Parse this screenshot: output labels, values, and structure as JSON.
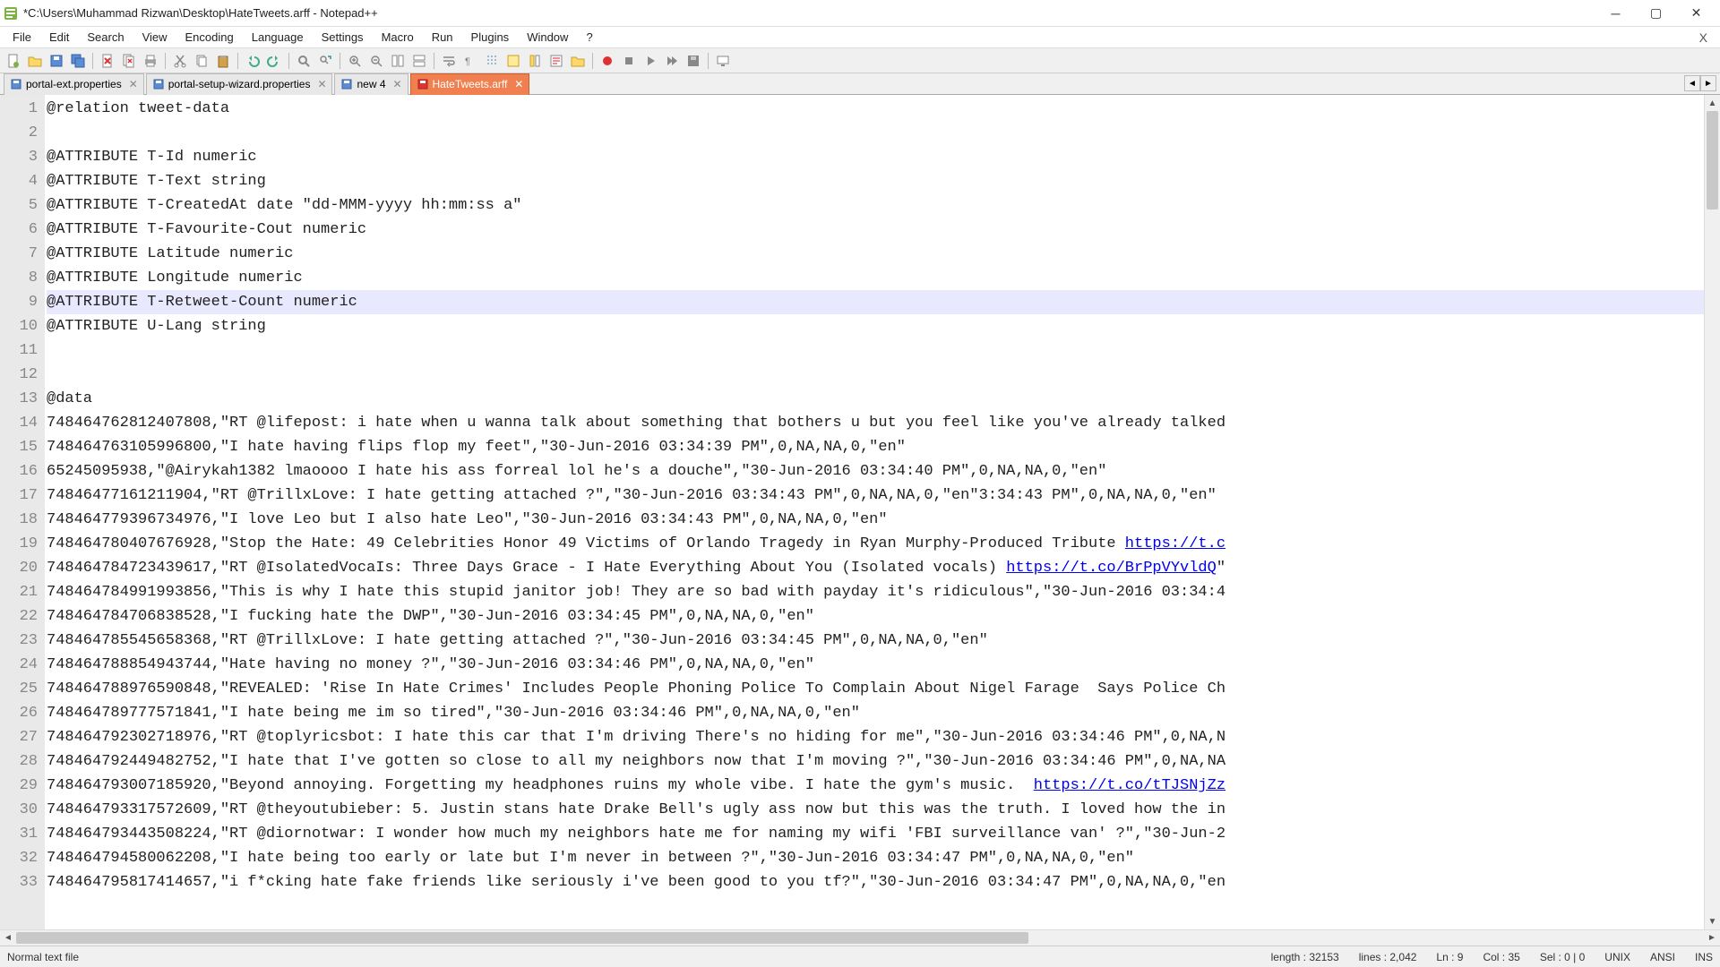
{
  "window": {
    "title": "*C:\\Users\\Muhammad Rizwan\\Desktop\\HateTweets.arff - Notepad++"
  },
  "menu": {
    "items": [
      "File",
      "Edit",
      "Search",
      "View",
      "Encoding",
      "Language",
      "Settings",
      "Macro",
      "Run",
      "Plugins",
      "Window",
      "?"
    ],
    "close_x": "X"
  },
  "tabs": [
    {
      "label": "portal-ext.properties",
      "active": false,
      "dirty": false
    },
    {
      "label": "portal-setup-wizard.properties",
      "active": false,
      "dirty": false
    },
    {
      "label": "new 4",
      "active": false,
      "dirty": false
    },
    {
      "label": "HateTweets.arff",
      "active": true,
      "dirty": true
    }
  ],
  "editor": {
    "current_line_index": 8,
    "lines": [
      "@relation tweet-data",
      "",
      "@ATTRIBUTE T-Id numeric",
      "@ATTRIBUTE T-Text string",
      "@ATTRIBUTE T-CreatedAt date \"dd-MMM-yyyy hh:mm:ss a\"",
      "@ATTRIBUTE T-Favourite-Cout numeric",
      "@ATTRIBUTE Latitude numeric",
      "@ATTRIBUTE Longitude numeric",
      "@ATTRIBUTE T-Retweet-Count numeric",
      "@ATTRIBUTE U-Lang string",
      "",
      "",
      "@data",
      "748464762812407808,\"RT @lifepost: i hate when u wanna talk about something that bothers u but you feel like you've already talked",
      "748464763105996800,\"I hate having flips flop my feet\",\"30-Jun-2016 03:34:39 PM\",0,NA,NA,0,\"en\"",
      "65245095938,\"@Airykah1382 lmaoooo I hate his ass forreal lol he's a douche\",\"30-Jun-2016 03:34:40 PM\",0,NA,NA,0,\"en\"",
      "74846477161211904,\"RT @TrillxLove: I hate getting attached ?\",\"30-Jun-2016 03:34:43 PM\",0,NA,NA,0,\"en\"3:34:43 PM\",0,NA,NA,0,\"en\"",
      "748464779396734976,\"I love Leo but I also hate Leo\",\"30-Jun-2016 03:34:43 PM\",0,NA,NA,0,\"en\"",
      "748464780407676928,\"Stop the Hate: 49 Celebrities Honor 49 Victims of Orlando Tragedy in Ryan Murphy-Produced Tribute https://t.c",
      "748464784723439617,\"RT @IsolatedVocaIs: Three Days Grace - I Hate Everything About You (Isolated vocals) https://t.co/BrPpVYvldQ\"",
      "748464784991993856,\"This is why I hate this stupid janitor job! They are so bad with payday it's ridiculous\",\"30-Jun-2016 03:34:4",
      "748464784706838528,\"I fucking hate the DWP\",\"30-Jun-2016 03:34:45 PM\",0,NA,NA,0,\"en\"",
      "748464785545658368,\"RT @TrillxLove: I hate getting attached ?\",\"30-Jun-2016 03:34:45 PM\",0,NA,NA,0,\"en\"",
      "748464788854943744,\"Hate having no money ?\",\"30-Jun-2016 03:34:46 PM\",0,NA,NA,0,\"en\"",
      "748464788976590848,\"REVEALED: 'Rise In Hate Crimes' Includes People Phoning Police To Complain About Nigel Farage  Says Police Ch",
      "748464789777571841,\"I hate being me im so tired\",\"30-Jun-2016 03:34:46 PM\",0,NA,NA,0,\"en\"",
      "748464792302718976,\"RT @toplyricsbot: I hate this car that I'm driving There's no hiding for me\",\"30-Jun-2016 03:34:46 PM\",0,NA,N",
      "748464792449482752,\"I hate that I've gotten so close to all my neighbors now that I'm moving ?\",\"30-Jun-2016 03:34:46 PM\",0,NA,NA",
      "748464793007185920,\"Beyond annoying. Forgetting my headphones ruins my whole vibe. I hate the gym's music.  https://t.co/tTJSNjZz",
      "748464793317572609,\"RT @theyoutubieber: 5. Justin stans hate Drake Bell's ugly ass now but this was the truth. I loved how the in",
      "748464793443508224,\"RT @diornotwar: I wonder how much my neighbors hate me for naming my wifi 'FBI surveillance van' ?\",\"30-Jun-2",
      "748464794580062208,\"I hate being too early or late but I'm never in between ?\",\"30-Jun-2016 03:34:47 PM\",0,NA,NA,0,\"en\"",
      "748464795817414657,\"i f*cking hate fake friends like seriously i've been good to you tf?\",\"30-Jun-2016 03:34:47 PM\",0,NA,NA,0,\"en"
    ],
    "link_lines": {
      "18": "https://t.c",
      "19": "https://t.co/BrPpVYvldQ",
      "28": "https://t.co/tTJSNjZz"
    }
  },
  "status": {
    "file_type": "Normal text file",
    "length": "length : 32153",
    "lines": "lines : 2,042",
    "ln": "Ln : 9",
    "col": "Col : 35",
    "sel": "Sel : 0 | 0",
    "eol": "UNIX",
    "encoding": "ANSI",
    "mode": "INS"
  }
}
